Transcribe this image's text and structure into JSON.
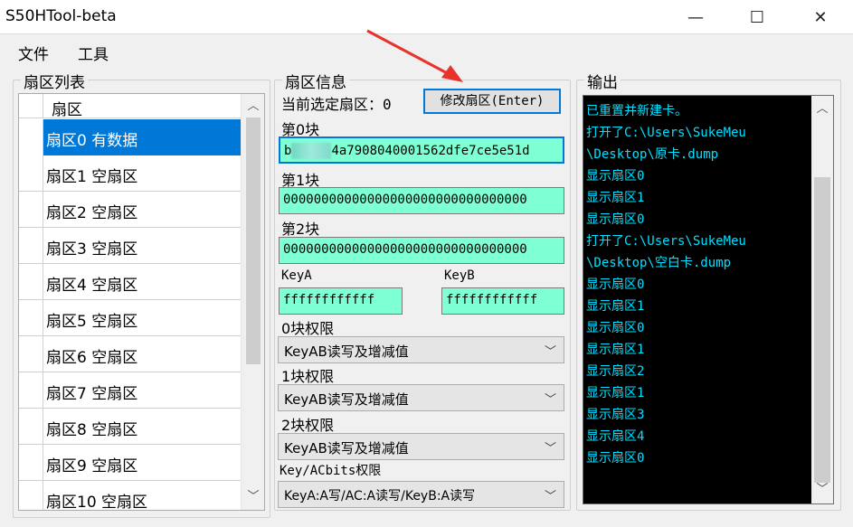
{
  "window": {
    "title": "S50HTool-beta",
    "minimize_glyph": "—",
    "maximize_glyph": "☐",
    "close_glyph": "✕"
  },
  "menu": [
    "文件",
    "工具"
  ],
  "sector_list": {
    "label": "扇区列表",
    "column_header": "扇区",
    "rows": [
      "扇区0 有数据",
      "扇区1 空扇区",
      "扇区2 空扇区",
      "扇区3 空扇区",
      "扇区4 空扇区",
      "扇区5 空扇区",
      "扇区6 空扇区",
      "扇区7 空扇区",
      "扇区8 空扇区",
      "扇区9 空扇区",
      "扇区10 空扇区"
    ],
    "selected_index": 0
  },
  "sector_info": {
    "label": "扇区信息",
    "current_label": "当前选定扇区：0",
    "modify_button": "修改扇区(Enter)",
    "block0_label": "第0块",
    "block0_prefix": "b",
    "block0_value": "4a7908040001562dfe7ce5e51d",
    "block1_label": "第1块",
    "block1_value": "00000000000000000000000000000000",
    "block2_label": "第2块",
    "block2_value": "00000000000000000000000000000000",
    "keya_label": "KeyA",
    "keya_value": "ffffffffffff",
    "keyb_label": "KeyB",
    "keyb_value": "ffffffffffff",
    "perm0_label": "0块权限",
    "perm0_value": "KeyAB读写及增减值",
    "perm1_label": "1块权限",
    "perm1_value": "KeyAB读写及增减值",
    "perm2_label": "2块权限",
    "perm2_value": "KeyAB读写及增减值",
    "permkey_label": "Key/ACbits权限",
    "permkey_value": "KeyA:A写/AC:A读写/KeyB:A读写"
  },
  "output": {
    "label": "输出",
    "lines": [
      "已重置并新建卡。",
      "打开了C:\\Users\\SukeMeu",
      "\\Desktop\\原卡.dump",
      "显示扇区0",
      "显示扇区1",
      "显示扇区0",
      "打开了C:\\Users\\SukeMeu",
      "\\Desktop\\空白卡.dump",
      "显示扇区0",
      "显示扇区1",
      "显示扇区0",
      "显示扇区1",
      "显示扇区2",
      "显示扇区1",
      "显示扇区3",
      "显示扇区4",
      "显示扇区0"
    ]
  },
  "colors": {
    "selection": "#0078d7",
    "hex_field_bg": "#7fffd4",
    "console_bg": "#000000",
    "console_text": "#00e0ff",
    "annotation_arrow": "#e8322b"
  },
  "icons": {
    "scroll_up": "chevron-up-icon",
    "scroll_down": "chevron-down-icon",
    "combo_open": "chevron-down-icon"
  }
}
